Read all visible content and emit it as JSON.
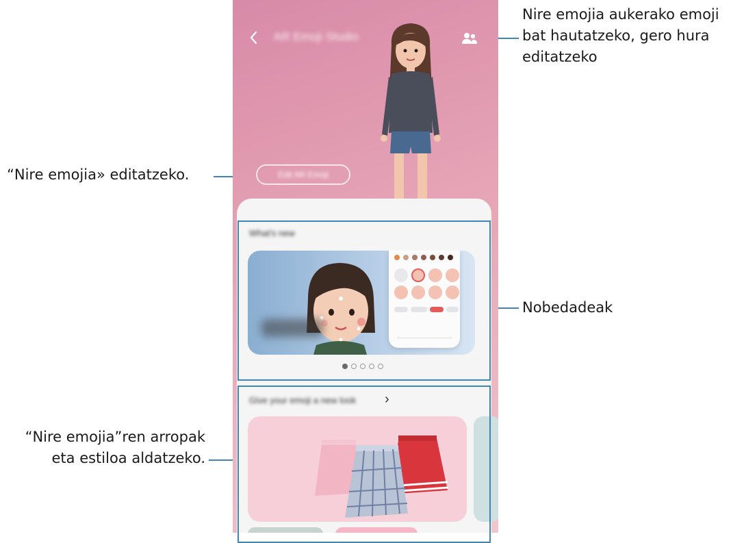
{
  "callouts": {
    "top_right": "Nire emojia aukerako emoji bat hautatzeko, gero hura editatzeko",
    "top_right_lines": [
      "Nire emojia aukerako emoji",
      "bat hautatzeko, gero hura",
      "editatzeko"
    ],
    "edit": "“Nire emojia» editatzeko.",
    "news": "Nobedadeak",
    "clothes_lines": [
      "“Nire emojia”ren arropak",
      "eta estiloa aldatzeko."
    ]
  },
  "app": {
    "title": "AR Emoji Studio",
    "edit_button": "Edit AR Emoji",
    "whats_new_title": "What's new",
    "style_section_title": "Give your emoji a new look",
    "chevron": "›",
    "carousel": {
      "pages": 5,
      "active": 0
    }
  },
  "icons": [
    "back-icon",
    "friends-icon",
    "chevron-right-icon"
  ],
  "colors": {
    "accent_line": "#3f86b8",
    "header_pink": "#e6a5b6",
    "card_blue": "#b6cde6",
    "cloth_card": "#f7cfd8"
  }
}
